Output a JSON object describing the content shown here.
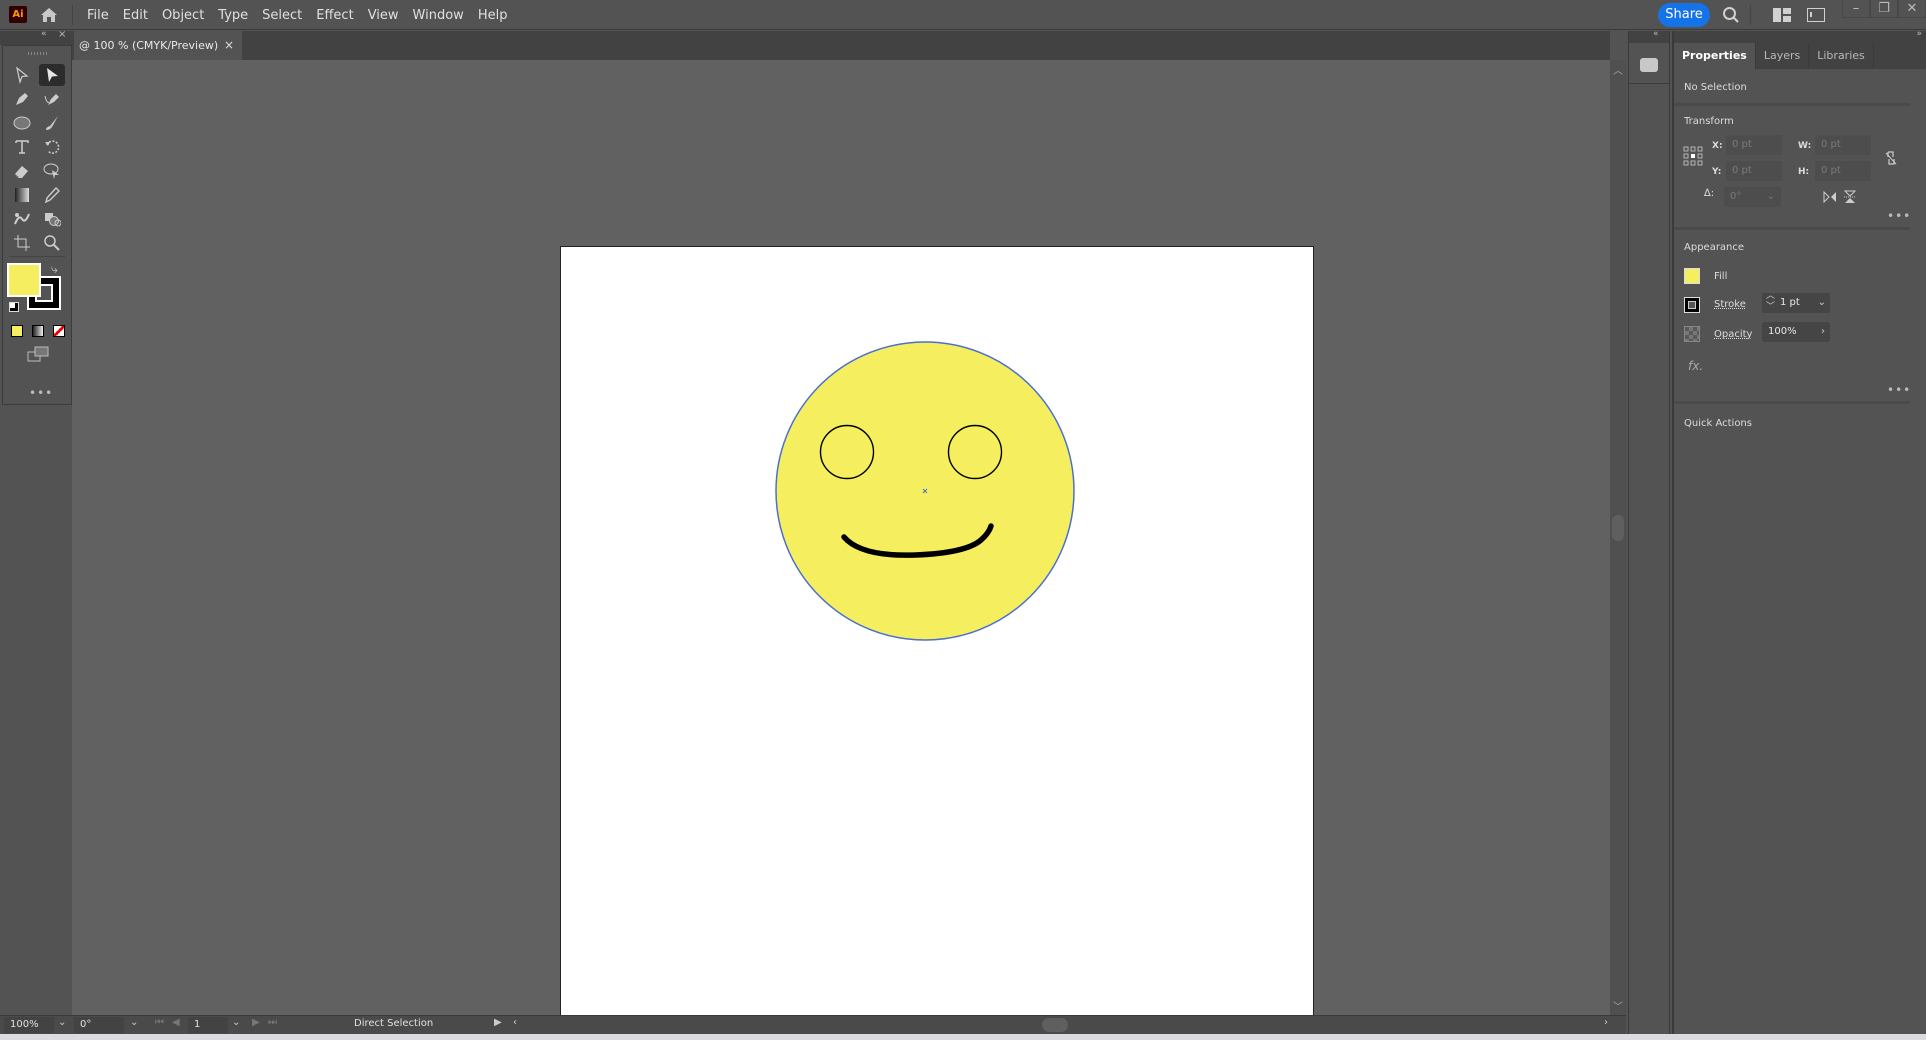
{
  "app": {
    "logo": "Ai"
  },
  "menu": [
    "File",
    "Edit",
    "Object",
    "Type",
    "Select",
    "Effect",
    "View",
    "Window",
    "Help"
  ],
  "top_right": {
    "share_label": "Share",
    "minimize": "–",
    "restore": "❐",
    "close": "✕"
  },
  "document_tab": {
    "title": "@ 100 % (CMYK/Preview)",
    "close": "×"
  },
  "tools": [
    "selection-tool",
    "direct-selection-tool",
    "pen-tool",
    "curvature-tool",
    "ellipse-tool",
    "paintbrush-tool",
    "type-tool",
    "rotate-tool",
    "eraser-tool",
    "lasso-tool",
    "gradient-tool",
    "eyedropper-tool",
    "puppet-warp-tool",
    "shape-builder-tool",
    "artboard-tool",
    "zoom-tool"
  ],
  "colors": {
    "fill": "#f5ef5f",
    "stroke": "#000000",
    "accent": "#1473e6",
    "selection_outline": "#4a6fd0"
  },
  "toolbar_more": "•••",
  "status_bar": {
    "zoom": "100%",
    "rotation": "0°",
    "artboard_number": "1",
    "current_tool": "Direct Selection"
  },
  "panel": {
    "tabs": [
      "Properties",
      "Layers",
      "Libraries"
    ],
    "active_tab": "Properties",
    "selection_state": "No Selection",
    "transform": {
      "title": "Transform",
      "x_label": "X:",
      "x_value": "0 pt",
      "y_label": "Y:",
      "y_value": "0 pt",
      "w_label": "W:",
      "w_value": "0 pt",
      "h_label": "H:",
      "h_value": "0 pt",
      "angle_label": "∆:",
      "angle_value": "0°"
    },
    "appearance": {
      "title": "Appearance",
      "fill_label": "Fill",
      "stroke_label": "Stroke",
      "stroke_value": "1 pt",
      "opacity_label": "Opacity",
      "opacity_value": "100%",
      "fx_label": "fx."
    },
    "more": "•••",
    "quick_actions_title": "Quick Actions"
  }
}
